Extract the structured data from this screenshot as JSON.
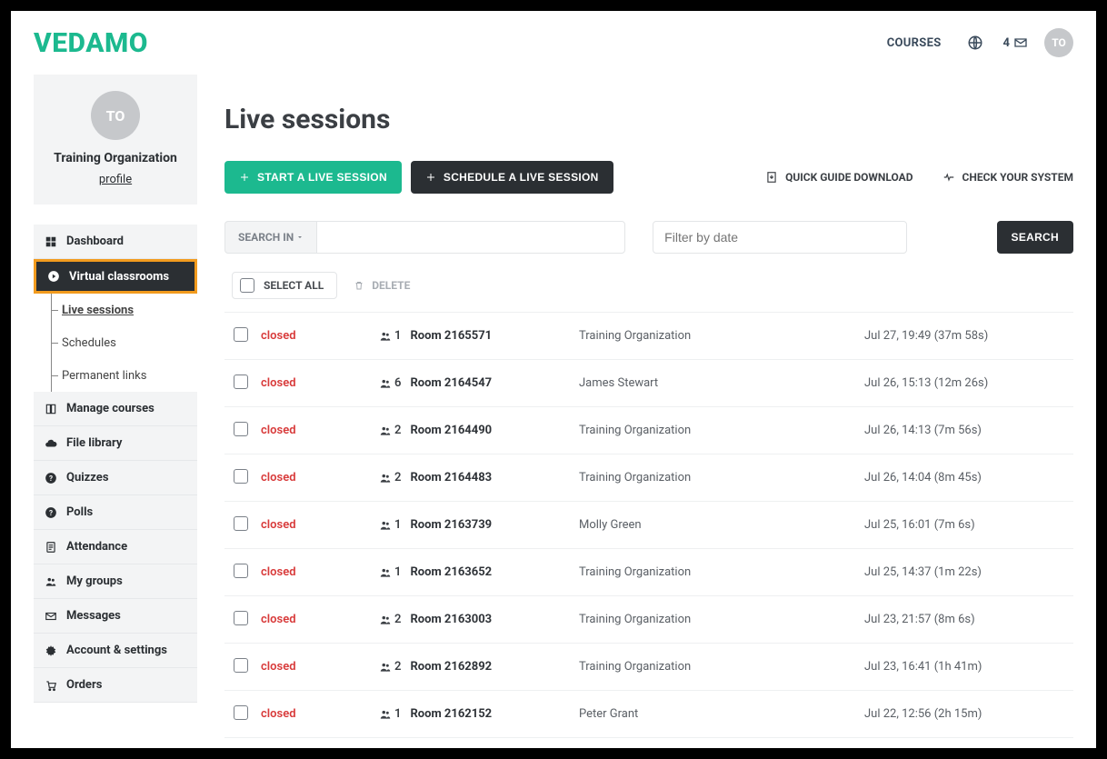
{
  "header": {
    "logo": "VEDAMO",
    "courses_link": "COURSES",
    "notif_count": "4",
    "avatar_initials": "TO"
  },
  "profile": {
    "avatar_initials": "TO",
    "name": "Training Organization",
    "profile_link": "profile"
  },
  "nav": {
    "dashboard": "Dashboard",
    "virtual": "Virtual classrooms",
    "virtual_subs": {
      "live": "Live sessions",
      "schedules": "Schedules",
      "permanent": "Permanent links"
    },
    "manage_courses": "Manage courses",
    "file_library": "File library",
    "quizzes": "Quizzes",
    "polls": "Polls",
    "attendance": "Attendance",
    "my_groups": "My groups",
    "messages": "Messages",
    "account": "Account & settings",
    "orders": "Orders"
  },
  "page": {
    "title": "Live sessions",
    "start_btn": "START A LIVE SESSION",
    "schedule_btn": "SCHEDULE A LIVE SESSION",
    "quick_guide": "QUICK GUIDE DOWNLOAD",
    "check_system": "CHECK YOUR SYSTEM",
    "search_in": "SEARCH IN",
    "date_placeholder": "Filter by date",
    "search_btn": "SEARCH",
    "select_all": "SELECT ALL",
    "delete": "DELETE"
  },
  "sessions": [
    {
      "status": "closed",
      "users": "1",
      "room": "Room 2165571",
      "organizer": "Training Organization",
      "time": "Jul 27, 19:49 (37m 58s)"
    },
    {
      "status": "closed",
      "users": "6",
      "room": "Room 2164547",
      "organizer": "James Stewart",
      "time": "Jul 26, 15:13 (12m 26s)"
    },
    {
      "status": "closed",
      "users": "2",
      "room": "Room 2164490",
      "organizer": "Training Organization",
      "time": "Jul 26, 14:13 (7m 56s)"
    },
    {
      "status": "closed",
      "users": "2",
      "room": "Room 2164483",
      "organizer": "Training Organization",
      "time": "Jul 26, 14:04 (8m 45s)"
    },
    {
      "status": "closed",
      "users": "1",
      "room": "Room 2163739",
      "organizer": "Molly Green",
      "time": "Jul 25, 16:01 (7m 6s)"
    },
    {
      "status": "closed",
      "users": "1",
      "room": "Room 2163652",
      "organizer": "Training Organization",
      "time": "Jul 25, 14:37 (1m 22s)"
    },
    {
      "status": "closed",
      "users": "2",
      "room": "Room 2163003",
      "organizer": "Training Organization",
      "time": "Jul 23, 21:57 (8m 6s)"
    },
    {
      "status": "closed",
      "users": "2",
      "room": "Room 2162892",
      "organizer": "Training Organization",
      "time": "Jul 23, 16:41 (1h 41m)"
    },
    {
      "status": "closed",
      "users": "1",
      "room": "Room 2162152",
      "organizer": "Peter Grant",
      "time": "Jul 22, 12:56 (2h 15m)"
    }
  ]
}
